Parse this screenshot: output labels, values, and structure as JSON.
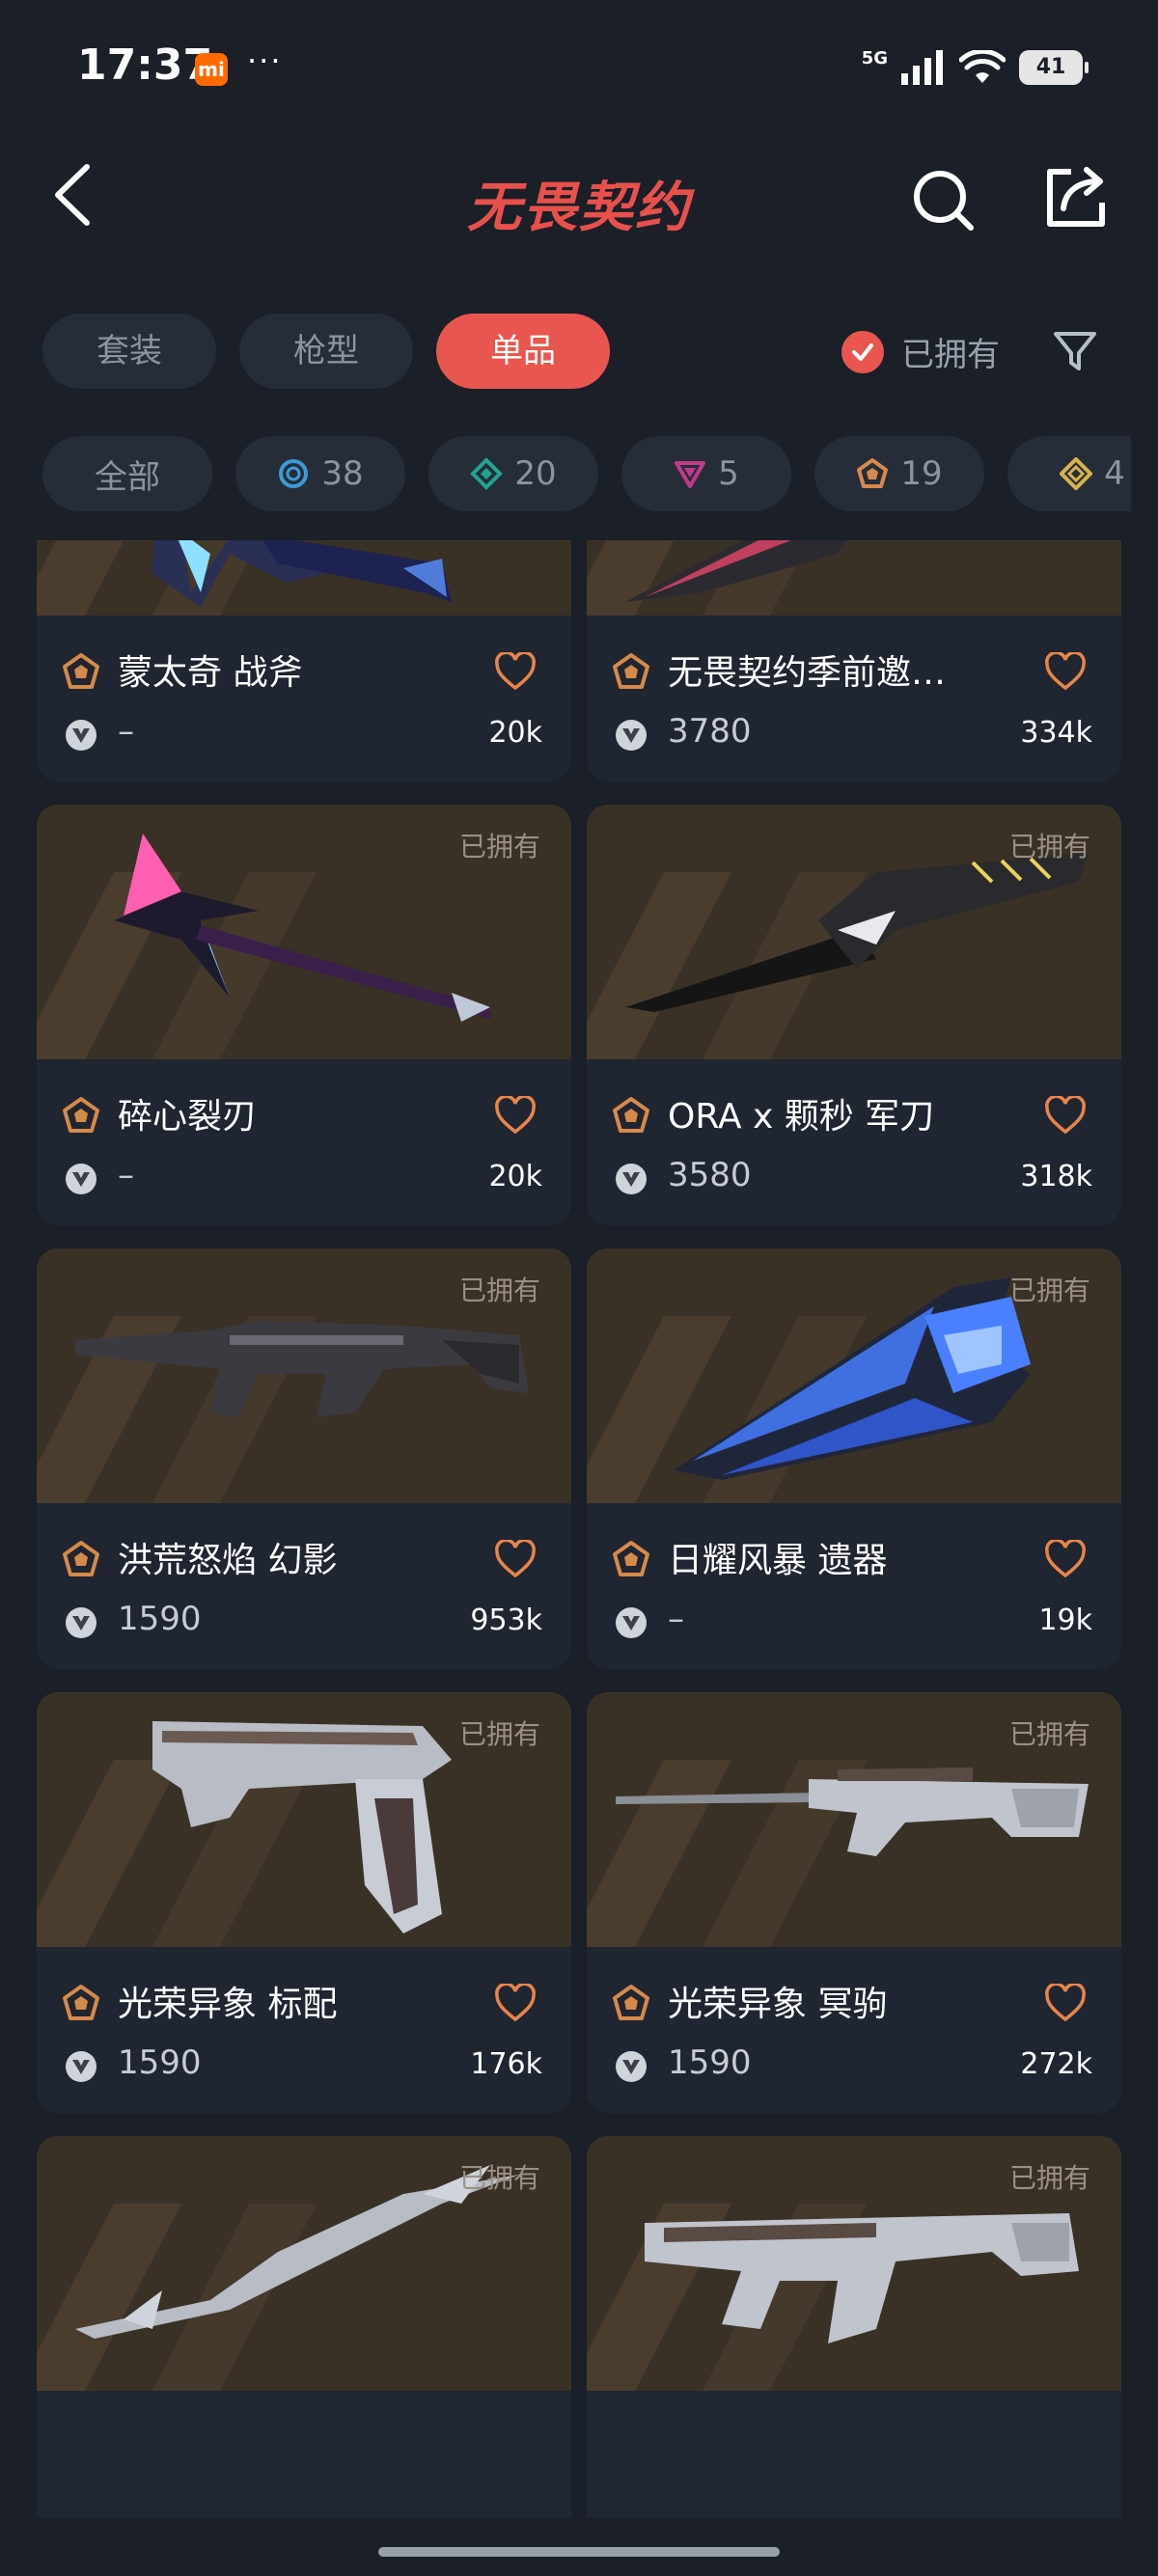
{
  "status_bar": {
    "time": "17:37",
    "app_badge": "mi",
    "dots": "···",
    "network": "5G",
    "battery": "41"
  },
  "header": {
    "title": "无畏契约"
  },
  "tabs": [
    {
      "label": "套装",
      "active": false
    },
    {
      "label": "枪型",
      "active": false
    },
    {
      "label": "单品",
      "active": true
    }
  ],
  "owned_filter": {
    "label": "已拥有",
    "checked": true
  },
  "chips": [
    {
      "label": "全部",
      "icon": ""
    },
    {
      "label": "38",
      "icon": "select-tier-icon",
      "color": "#3b9bd6"
    },
    {
      "label": "20",
      "icon": "deluxe-tier-icon",
      "color": "#1fa58f"
    },
    {
      "label": "5",
      "icon": "premium-tier-icon",
      "color": "#c23a8c"
    },
    {
      "label": "19",
      "icon": "exclusive-tier-icon",
      "color": "#d68a4a"
    },
    {
      "label": "4",
      "icon": "ultra-tier-icon",
      "color": "#d8b34a"
    }
  ],
  "cards": [
    {
      "name": "蒙太奇 战斧",
      "price": "–",
      "likes": "20k",
      "owned": "",
      "weapon": "axe"
    },
    {
      "name": "无畏契约季前邀…",
      "price": "3780",
      "likes": "334k",
      "owned": "",
      "weapon": "knife"
    },
    {
      "name": "碎心裂刃",
      "price": "–",
      "likes": "20k",
      "owned": "已拥有",
      "weapon": "guitar"
    },
    {
      "name": "ORA x 颗秒 军刀",
      "price": "3580",
      "likes": "318k",
      "owned": "已拥有",
      "weapon": "blade"
    },
    {
      "name": "洪荒怒焰 幻影",
      "price": "1590",
      "likes": "953k",
      "owned": "已拥有",
      "weapon": "rifle"
    },
    {
      "name": "日耀风暴 遗器",
      "price": "–",
      "likes": "19k",
      "owned": "已拥有",
      "weapon": "crystal"
    },
    {
      "name": "光荣异象 标配",
      "price": "1590",
      "likes": "176k",
      "owned": "已拥有",
      "weapon": "pistol"
    },
    {
      "name": "光荣异象 冥驹",
      "price": "1590",
      "likes": "272k",
      "owned": "已拥有",
      "weapon": "sniper"
    },
    {
      "name": "",
      "price": "",
      "likes": "",
      "owned": "已拥有",
      "weapon": "scythe"
    },
    {
      "name": "",
      "price": "",
      "likes": "",
      "owned": "已拥有",
      "weapon": "smg"
    }
  ],
  "colors": {
    "accent": "#e9564f",
    "background": "#1a1f28",
    "tier_exclusive": "#d68a4a"
  }
}
